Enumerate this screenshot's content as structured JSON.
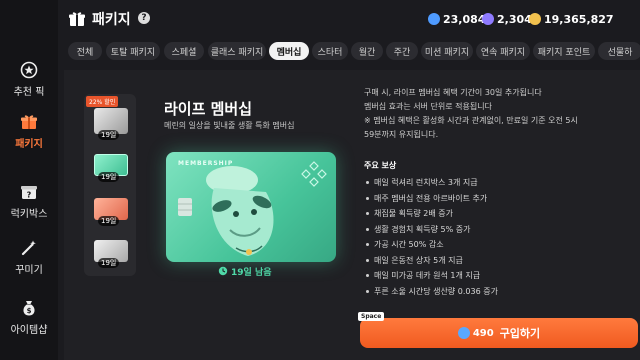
{
  "header": {
    "title": "패키지",
    "help": "?",
    "currencies": [
      {
        "name": "blue-gem",
        "value": "23,084",
        "color": "#4f9bff"
      },
      {
        "name": "purple-gem",
        "value": "2,304",
        "color": "#8f7bff"
      },
      {
        "name": "gold-coin",
        "value": "19,365,827",
        "color": "#f2c14e"
      }
    ]
  },
  "sidebar": {
    "items": [
      {
        "label": "추천 픽",
        "icon": "star-badge-icon"
      },
      {
        "label": "패키지",
        "icon": "package-icon",
        "active": true
      },
      {
        "label": "럭키박스",
        "icon": "lucky-box-icon"
      },
      {
        "label": "꾸미기",
        "icon": "magic-wand-icon"
      },
      {
        "label": "아이템샵",
        "icon": "money-bag-icon"
      }
    ]
  },
  "tabs": [
    "전체",
    "토탈 패키지",
    "스페셜",
    "클래스 패키지",
    "멤버십",
    "스타터",
    "월간",
    "주간",
    "미션 패키지",
    "연속 패키지",
    "패키지 포인트",
    "선물하"
  ],
  "active_tab": "멤버십",
  "package": {
    "sale_badge": "22% 할인",
    "thumb_badges": [
      "19일",
      "19일",
      "19일",
      "19일"
    ],
    "title": "라이프 멤버십",
    "subtitle": "메린의 일상을 빛내줄 생활 특화 멤버십",
    "card_label": "MEMBERSHIP",
    "remaining": "19일 남음"
  },
  "description": [
    "구매 시, 라이프 멤버십 혜택 기간이 30일 추가됩니다",
    "멤버십 효과는 서버 단위로 적용됩니다",
    "※ 멤버십 혜택은 활성화 시간과 관계없이, 만료일 기준 오전 5시",
    "59분까지 유지됩니다."
  ],
  "rewards_title": "주요 보상",
  "rewards": [
    "매일 럭셔리 런치박스 3개 지급",
    "매주 멤버십 전용 아르바이트 추가",
    "채집물 획득량 2배 증가",
    "생활 경험치 획득량 5% 증가",
    "가공 시간 50% 감소",
    "매일 은동전 상자 5개 지급",
    "매일 미가공 데카 원석 1개 지급",
    "푸른 소울 시간당 생산량 0.036 증가"
  ],
  "buy": {
    "key_hint": "Space",
    "price": "490",
    "label": "구입하기"
  }
}
